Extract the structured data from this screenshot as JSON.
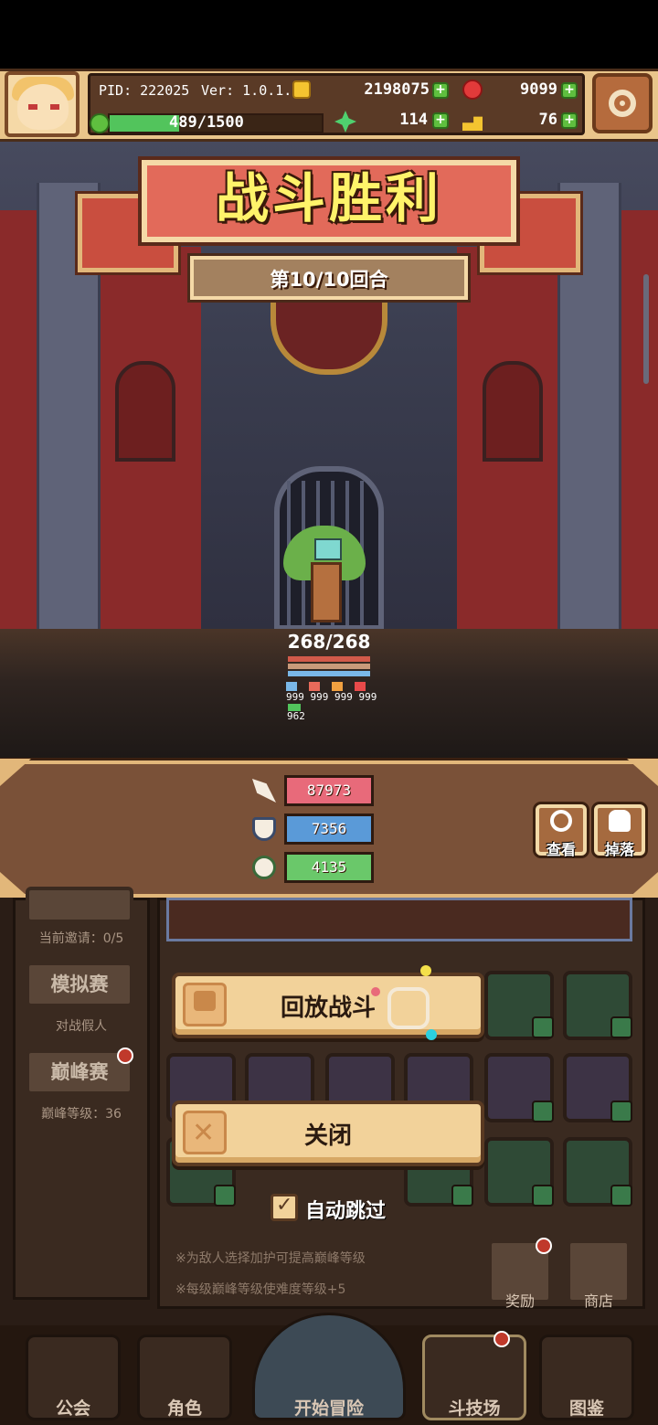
{
  "hud": {
    "pid": "PID: 222025",
    "version": "Ver: 1.0.1.11",
    "gold": "2198075",
    "gems": "9099",
    "stamina_text": "489/1500",
    "stamina_fraction": 0.326,
    "clover": "114",
    "keys": "76"
  },
  "battle": {
    "title": "战斗胜利",
    "round": "第10/10回合",
    "hero_hp": "268/268",
    "buffs": "999 999 999 999",
    "buff_extra": "962"
  },
  "stats": {
    "attack": "87973",
    "defense": "7356",
    "heal": "4135",
    "view_label": "查看",
    "drop_label": "掉落"
  },
  "actions": {
    "replay_label": "回放战斗",
    "close_label": "关闭",
    "autoskip_label": "自动跳过",
    "autoskip_checked": true
  },
  "lower": {
    "invite_info": "当前邀请：0/5",
    "sim_label": "模拟赛",
    "sim_desc": "对战假人",
    "peak_label": "巅峰赛",
    "peak_desc": "巅峰等级：36",
    "note1": "※为敌人选择加护可提高巅峰等级",
    "note2": "※每级巅峰等级使难度等级+5",
    "reward_label": "奖励",
    "shop_label": "商店"
  },
  "nav": {
    "guild": "公会",
    "character": "角色",
    "adventure": "开始冒险",
    "arena": "斗技场",
    "codex": "图鉴"
  },
  "colors": {
    "title_yellow": "#fff36a",
    "attack_bar": "#e86a7a",
    "defense_bar": "#5a9ad8",
    "heal_bar": "#6ac86a",
    "button_cream": "#f2d29a"
  },
  "icons": {
    "settings": "gear-icon",
    "gold": "gold-coin-icon",
    "gem": "red-gem-icon",
    "stamina": "stamina-icon",
    "clover": "clover-icon",
    "key": "key-icon",
    "attack": "sword-icon",
    "defense": "shield-icon",
    "heal": "heal-icon"
  }
}
